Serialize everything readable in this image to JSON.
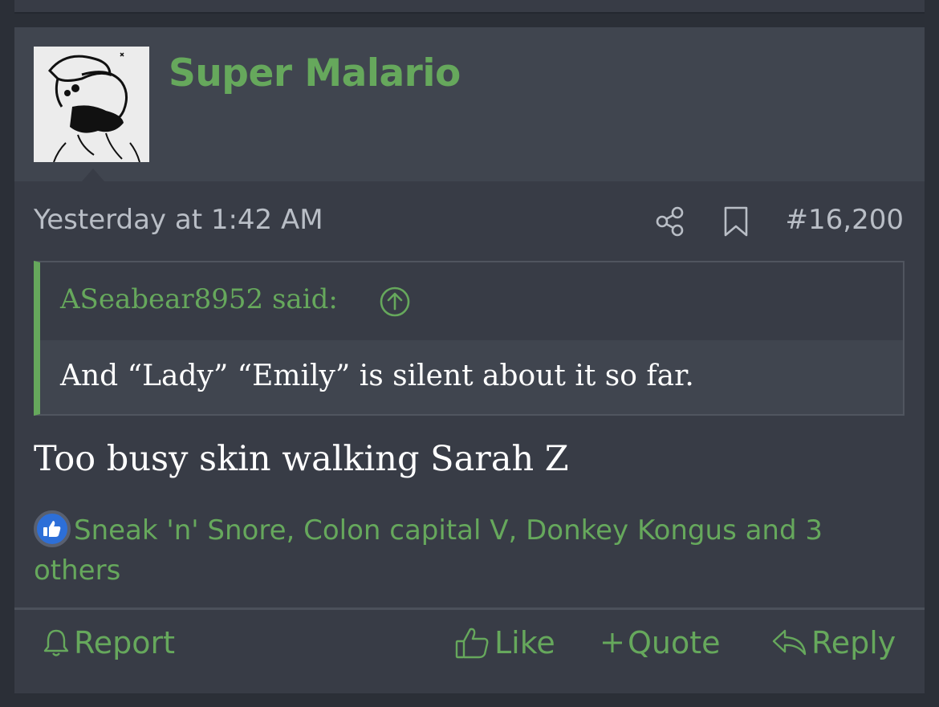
{
  "post": {
    "author": "Super Malario",
    "timestamp": "Yesterday at 1:42 AM",
    "post_number": "#16,200",
    "icons": {
      "share": "share-icon",
      "bookmark": "bookmark-icon"
    }
  },
  "quote": {
    "author_label": "ASeabear8952 said:",
    "jump_icon": "arrow-up-circle-icon",
    "text": "And “Lady” “Emily” is silent about it so far."
  },
  "message": "Too busy skin walking Sarah Z",
  "reactions": {
    "icon": "thumbs-up-icon",
    "text": "Sneak 'n' Snore, Colon capital V, Donkey Kongus and 3 others"
  },
  "actions": {
    "report": "Report",
    "like": "Like",
    "quote": "Quote",
    "reply": "Reply"
  },
  "colors": {
    "accent": "#66a85c",
    "background": "#2b2f37",
    "card": "#383c46",
    "header": "#40454f"
  }
}
